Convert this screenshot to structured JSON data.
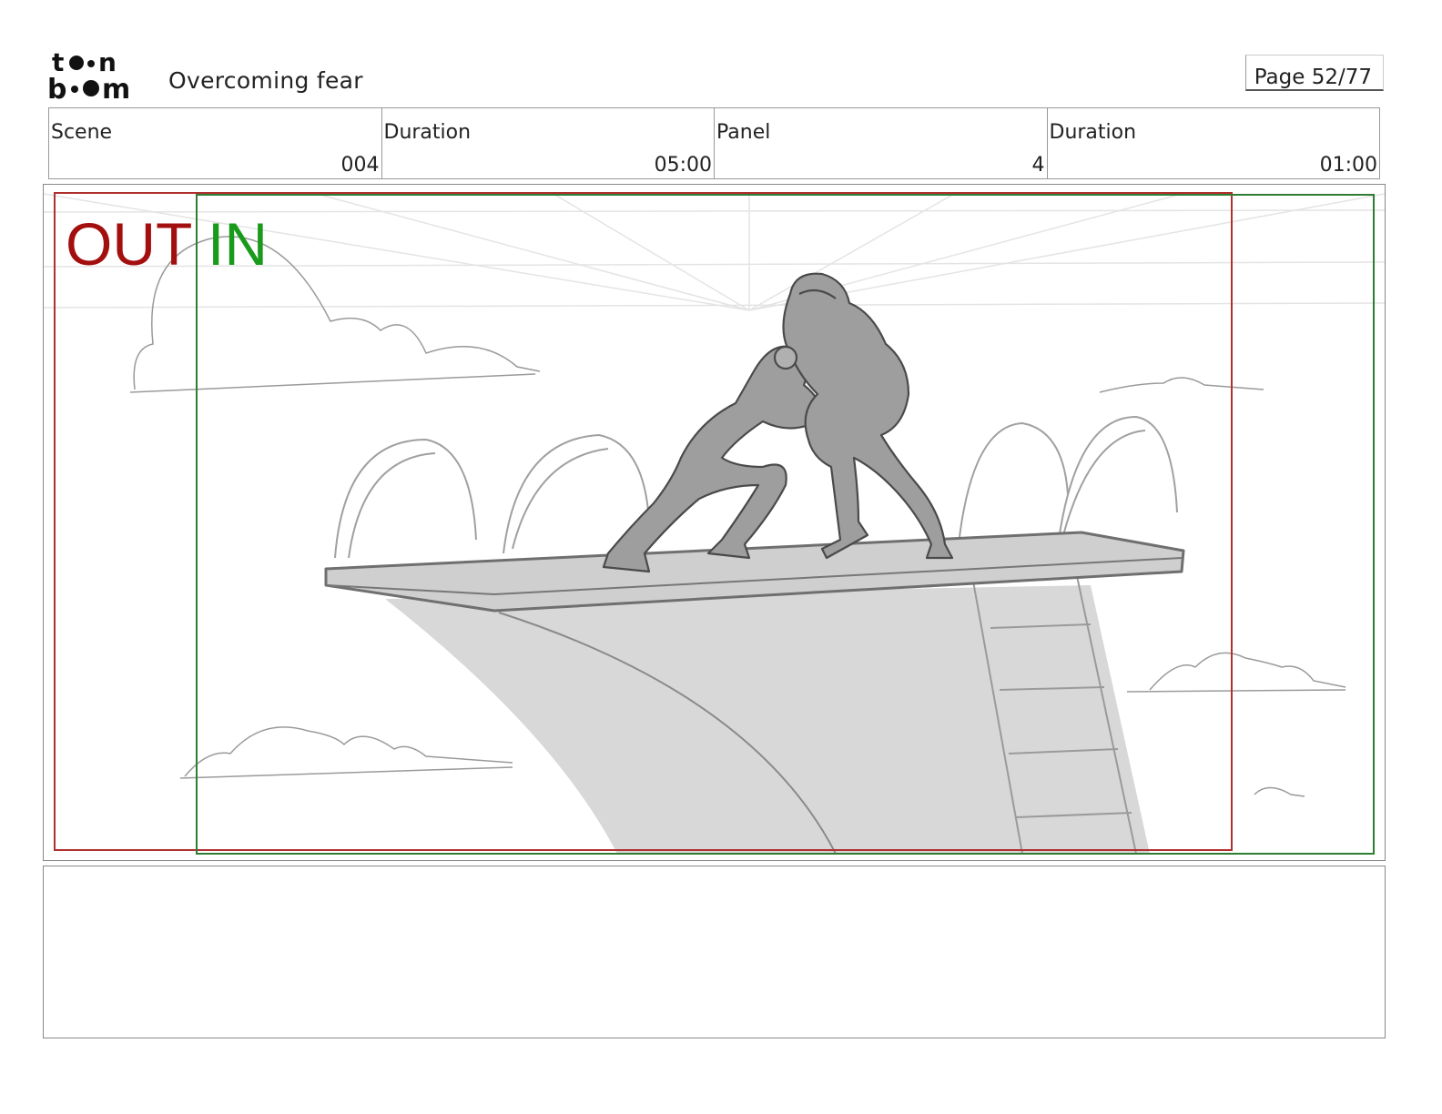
{
  "header": {
    "logo_text_top": "toon",
    "logo_text_bottom": "boom",
    "title": "Overcoming fear",
    "page_label": "Page 52/77"
  },
  "info": {
    "scene_label": "Scene",
    "scene_value": "004",
    "scene_duration_label": "Duration",
    "scene_duration_value": "05:00",
    "panel_label": "Panel",
    "panel_value": "4",
    "panel_duration_label": "Duration",
    "panel_duration_value": "01:00"
  },
  "panel": {
    "out_label": "OUT",
    "in_label": "IN",
    "out_color": "#a30f0f",
    "in_color": "#1a9a1a",
    "out_frame_color": "#b03030",
    "in_frame_color": "#2e7d32"
  },
  "notes": {
    "text": ""
  }
}
